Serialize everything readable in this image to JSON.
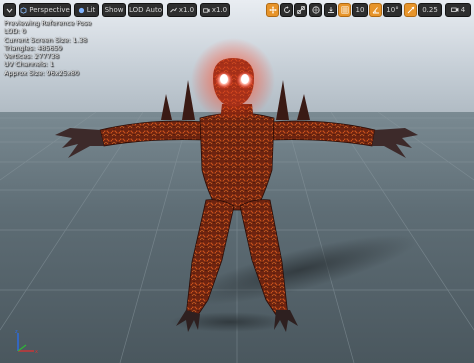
{
  "toolbar": {
    "perspective_label": "Perspective",
    "lit_label": "Lit",
    "show_label": "Show",
    "lod_label": "LOD Auto",
    "play_speed": "x1.0",
    "camera_speed": "x1.0",
    "grid_snap_value": "10",
    "rotation_snap_value": "10°",
    "scale_snap_value": "0.25",
    "camera_speed_setting": "4"
  },
  "info": {
    "title": "Previewing Reference Pose",
    "lod": "LOD: 0",
    "screen_size": "Current Screen Size: 1.38",
    "triangles": "Triangles: 485659",
    "vertices": "Vertices: 277738",
    "uv_channels": "UV Channels: 1",
    "approx_size": "Approx Size: 96x25x80"
  },
  "colors": {
    "sky_top": "#b7c3cf",
    "floor": "#5b6a72",
    "character_body": "#7a2a10",
    "character_glow": "#ff3a22",
    "toolbar_button": "#2e2e2e",
    "accent": "#e7942a"
  }
}
